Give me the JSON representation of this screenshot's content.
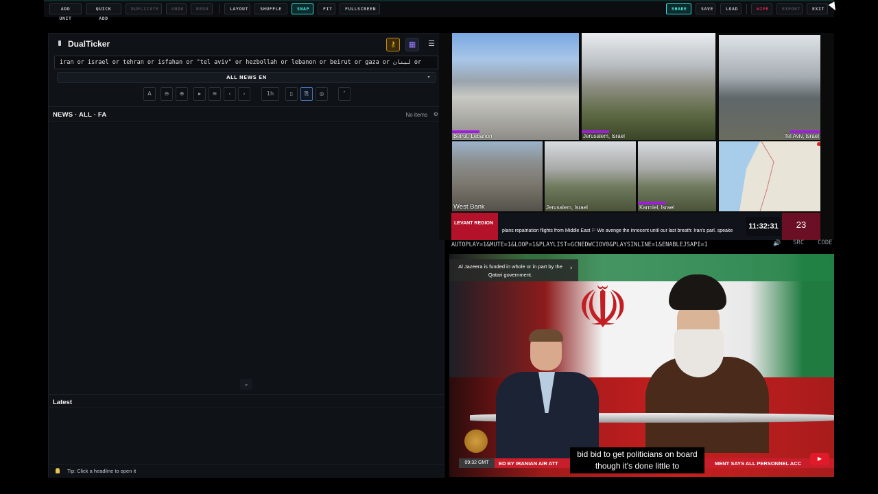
{
  "toolbar": {
    "add_unit": "ADD UNIT",
    "quick_add": "QUICK ADD",
    "duplicate": "DUPLICATE",
    "undo": "UNDO",
    "redo": "REDO",
    "layout": "LAYOUT",
    "shuffle": "SHUFFLE",
    "snap": "SNAP",
    "fit": "FIT",
    "fullscreen": "FULLSCREEN",
    "share": "SHARE",
    "save": "SAVE",
    "load": "LOAD",
    "wipe": "WIPE",
    "export": "EXPORT",
    "exit": "EXIT"
  },
  "panel": {
    "app_name": "DualTicker",
    "query": "iran or israel or tehran or isfahan or \"tel aviv\" or hezbollah or lebanon or beirut or gaza or لبنان or",
    "source_select": "ALL NEWS EN",
    "controls": [
      "A",
      "⊖",
      "⊕",
      "▸",
      "≋",
      "‹",
      "›",
      "1h",
      "▯",
      "⎘",
      "◎",
      "˄"
    ],
    "news_title": "NEWS · ALL · FA",
    "news_count": "No items",
    "latest_title": "Latest",
    "tip": "Tip: Click a headline to open it"
  },
  "cameras": [
    {
      "label": "Beirut, Lebanon"
    },
    {
      "label": "Jerusalem, Israel"
    },
    {
      "label": "Tel Aviv, Israel"
    },
    {
      "label": "West Bank"
    },
    {
      "label": "Jerusalem, Israel"
    },
    {
      "label": "Karmiel, Israel"
    },
    {
      "label": ""
    }
  ],
  "ticker": {
    "region": "LEVANT REGION",
    "headline": "plans repatriation flights from Middle East   ⚐ We avenge the innocent until our last breath: Iran's parl. speake",
    "clock": "11:32:31",
    "date": "23"
  },
  "stream": {
    "url": "AUTOPLAY=1&MUTE=1&LOOP=1&PLAYLIST=GCNEDWCIOV0&PLAYSINLINE=1&ENABLEJSAPI=1",
    "src_label": "SRC",
    "code_label": "CODE"
  },
  "video": {
    "funding_notice": "Al Jazeera is funded in whole or in part by the Qatari government.",
    "time": "09:32 GMT",
    "lower_third_left": "ED BY IRANIAN AIR ATT",
    "lower_third_right": "MENT SAYS ALL PERSONNEL ACC",
    "caption": "bid bid to get politicians on board though it's done little to"
  }
}
